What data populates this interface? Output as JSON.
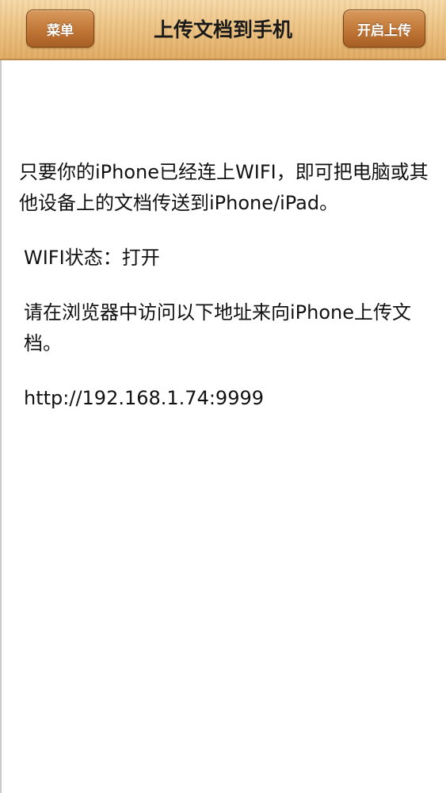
{
  "navbar": {
    "menu_label": "菜单",
    "title": "上传文档到手机",
    "start_upload_label": "开启上传"
  },
  "content": {
    "intro": "只要你的iPhone已经连上WIFI，即可把电脑或其他设备上的文档传送到iPhone/iPad。",
    "wifi_status": "WIFI状态：打开",
    "instruction": "请在浏览器中访问以下地址来向iPhone上传文档。",
    "url": "http://192.168.1.74:9999"
  }
}
